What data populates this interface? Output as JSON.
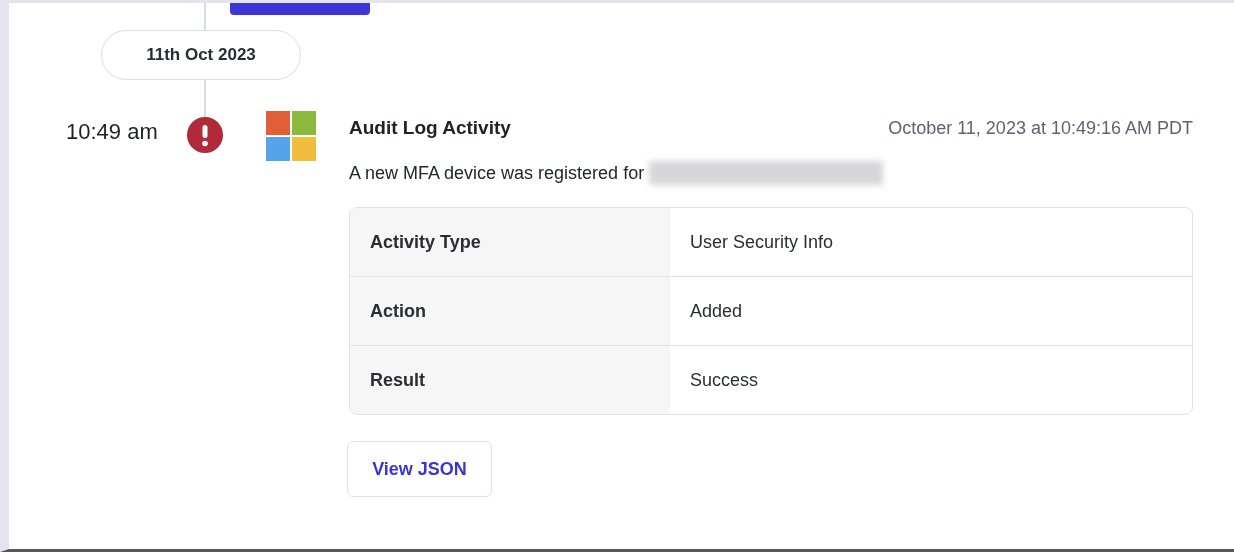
{
  "top_button": {
    "visible": true
  },
  "date_pill": "11th Oct 2023",
  "entry": {
    "time": "10:49 am",
    "alert": true,
    "title": "Audit Log Activity",
    "timestamp": "October 11, 2023 at 10:49:16 AM PDT",
    "description": "A new MFA device was registered for",
    "recipient_redacted": true,
    "details": [
      {
        "label": "Activity Type",
        "value": "User Security Info"
      },
      {
        "label": "Action",
        "value": "Added"
      },
      {
        "label": "Result",
        "value": "Success"
      }
    ],
    "button": "View JSON"
  }
}
